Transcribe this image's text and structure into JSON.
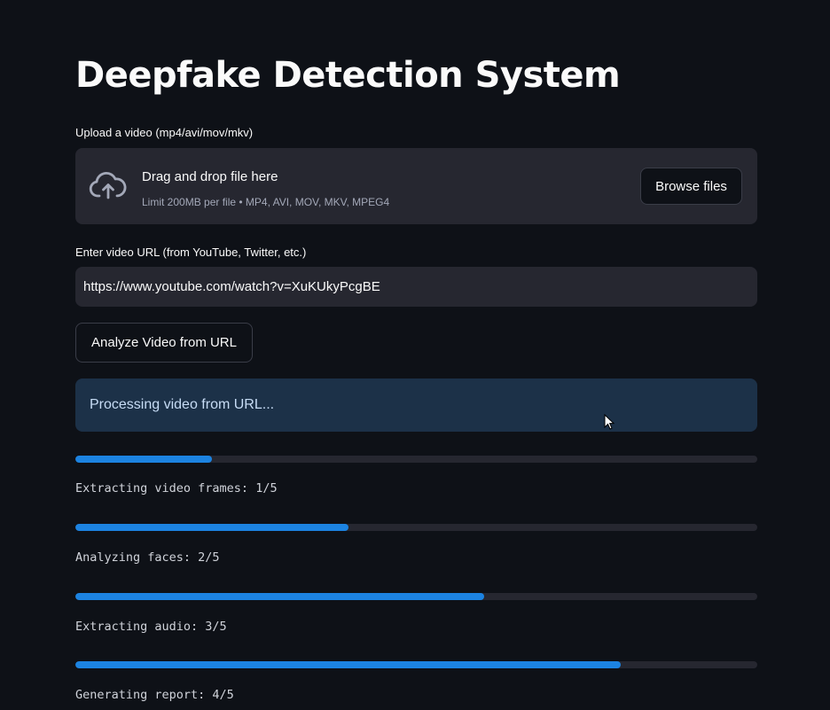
{
  "page": {
    "title": "Deepfake Detection System"
  },
  "upload": {
    "label": "Upload a video (mp4/avi/mov/mkv)",
    "drop_title": "Drag and drop file here",
    "limit_text": "Limit 200MB per file • MP4, AVI, MOV, MKV, MPEG4",
    "browse_label": "Browse files",
    "icon": "cloud-upload-icon"
  },
  "url": {
    "label": "Enter video URL (from YouTube, Twitter, etc.)",
    "value": "https://www.youtube.com/watch?v=XuKUkyPcgBE",
    "analyze_label": "Analyze Video from URL"
  },
  "status": {
    "message": "Processing video from URL..."
  },
  "progress": [
    {
      "fraction": 0.2,
      "text": "Extracting video frames: 1/5"
    },
    {
      "fraction": 0.4,
      "text": "Analyzing faces: 2/5"
    },
    {
      "fraction": 0.6,
      "text": "Extracting audio: 3/5"
    },
    {
      "fraction": 0.8,
      "text": "Generating report: 4/5"
    }
  ],
  "colors": {
    "background": "#0e1117",
    "surface": "#262730",
    "info_background": "#1c3148",
    "progress_fill": "#1c83e1"
  }
}
